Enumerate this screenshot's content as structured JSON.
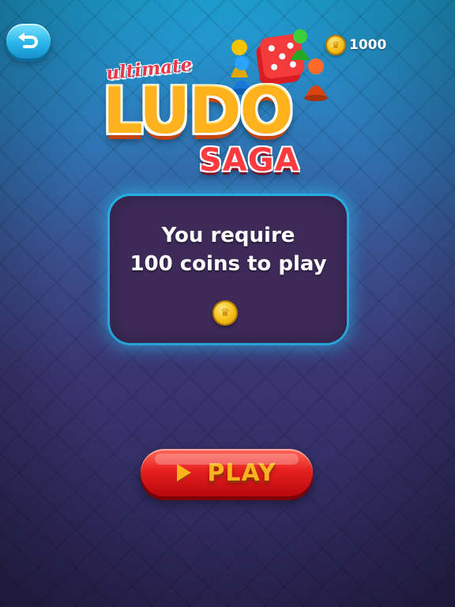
{
  "header": {
    "back_button": {
      "icon": "undo-arrow-icon"
    },
    "coins": {
      "icon": "coin-icon",
      "amount": "1000"
    }
  },
  "logo": {
    "line1": "ultimate",
    "line2": "LUDO",
    "line3": "SAGA"
  },
  "message": {
    "line1": "You require",
    "line2": "100 coins to play",
    "icon": "coin-icon"
  },
  "play_button": {
    "icon": "play-triangle-icon",
    "label": "PLAY"
  },
  "colors": {
    "background_top": "#1ea3d6",
    "background_bottom": "#2c2556",
    "panel": "#3d2a58",
    "panel_glow": "#28c8ff",
    "play_button": "#e8201f",
    "play_text": "#ffb21e",
    "logo_ludo": "#ffb21e",
    "logo_saga": "#ff3a3f"
  }
}
